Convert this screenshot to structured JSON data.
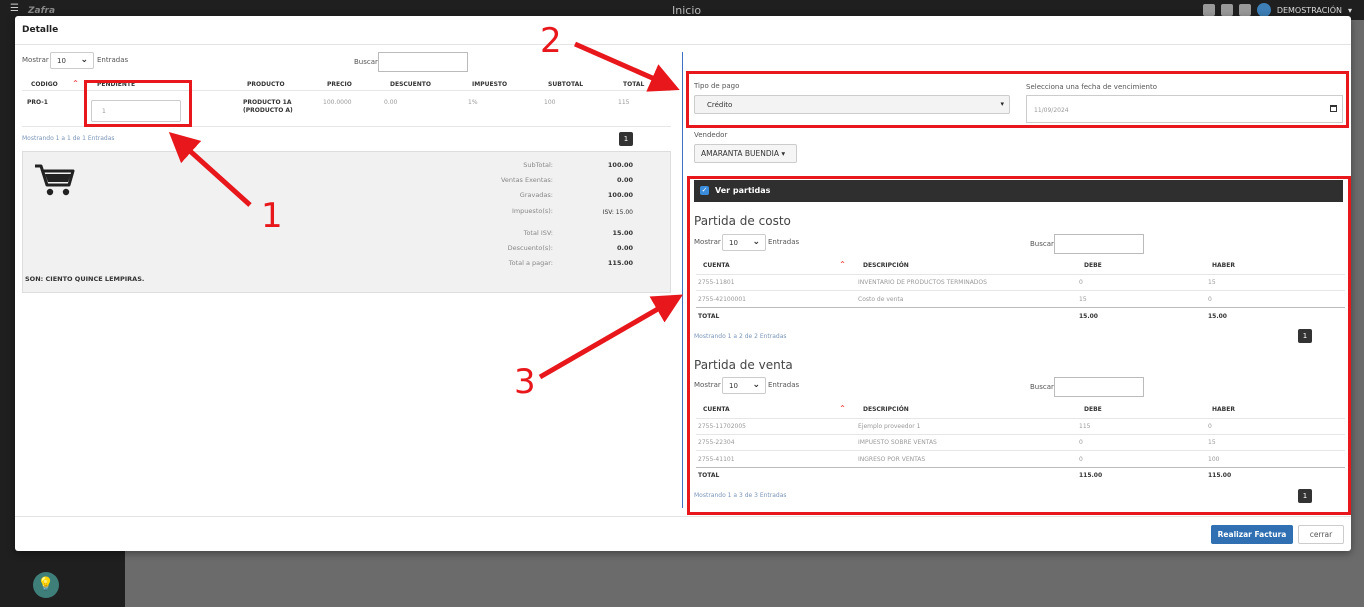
{
  "topbar": {
    "title": "Inicio",
    "logo": "Zafra",
    "user": "DEMOSTRACIÓN"
  },
  "modal": {
    "title": "Detalle"
  },
  "left": {
    "show_label": "Mostrar",
    "show_value": "10",
    "entries_label": "Entradas",
    "search_label": "Buscar:",
    "columns": [
      "CODIGO",
      "PENDIENTE",
      "PRODUCTO",
      "PRECIO",
      "DESCUENTO",
      "IMPUESTO",
      "SUBTOTAL",
      "TOTAL"
    ],
    "row": {
      "codigo": "PRO-1",
      "pendiente": "1",
      "producto_1": "PRODUCTO 1A",
      "producto_2": "(PRODUCTO A)",
      "precio": "100.0000",
      "descuento": "0.00",
      "impuesto": "1%",
      "subtotal": "100",
      "total": "115"
    },
    "info": "Mostrando 1 a 1 de 1 Entradas",
    "page": "1",
    "summary": {
      "subtotal_lbl": "SubTotal:",
      "subtotal_val": "100.00",
      "exentas_lbl": "Ventas Exentas:",
      "exentas_val": "0.00",
      "gravadas_lbl": "Gravadas:",
      "gravadas_val": "100.00",
      "impuesto_lbl": "Impuesto(s):",
      "impuesto_val": "ISV: 15.00",
      "totalisv_lbl": "Total ISV:",
      "totalisv_val": "15.00",
      "descuento_lbl": "Descuento(s):",
      "descuento_val": "0.00",
      "totalpagar_lbl": "Total a pagar:",
      "totalpagar_val": "115.00",
      "son": "SON: CIENTO QUINCE LEMPIRAS."
    }
  },
  "right": {
    "tipo_pago_label": "Tipo de pago",
    "tipo_pago_value": "Crédito",
    "fecha_label": "Selecciona una fecha de vencimiento",
    "fecha_value": "11/09/2024",
    "vendedor_label": "Vendedor",
    "vendedor_value": "AMARANTA BUENDIA",
    "ver_partidas": "Ver partidas",
    "costo": {
      "title": "Partida de costo",
      "show_label": "Mostrar",
      "show_value": "10",
      "entries_label": "Entradas",
      "search_label": "Buscar:",
      "columns": [
        "CUENTA",
        "DESCRIPCIÓN",
        "DEBE",
        "HABER"
      ],
      "rows": [
        {
          "cuenta": "2755-11801",
          "desc": "INVENTARIO DE PRODUCTOS TERMINADOS",
          "debe": "0",
          "haber": "15"
        },
        {
          "cuenta": "2755-42100001",
          "desc": "Costo de venta",
          "debe": "15",
          "haber": "0"
        }
      ],
      "total_label": "TOTAL",
      "total_debe": "15.00",
      "total_haber": "15.00",
      "info": "Mostrando 1 a 2 de 2 Entradas",
      "page": "1"
    },
    "venta": {
      "title": "Partida de venta",
      "show_label": "Mostrar",
      "show_value": "10",
      "entries_label": "Entradas",
      "search_label": "Buscar:",
      "columns": [
        "CUENTA",
        "DESCRIPCIÓN",
        "DEBE",
        "HABER"
      ],
      "rows": [
        {
          "cuenta": "2755-11702005",
          "desc": "Ejemplo proveedor 1",
          "debe": "115",
          "haber": "0"
        },
        {
          "cuenta": "2755-22304",
          "desc": "IMPUESTO SOBRE VENTAS",
          "debe": "0",
          "haber": "15"
        },
        {
          "cuenta": "2755-41101",
          "desc": "INGRESO POR VENTAS",
          "debe": "0",
          "haber": "100"
        }
      ],
      "total_label": "TOTAL",
      "total_debe": "115.00",
      "total_haber": "115.00",
      "info": "Mostrando 1 a 3 de 3 Entradas",
      "page": "1"
    }
  },
  "footer": {
    "realizar": "Realizar Factura",
    "cerrar": "cerrar"
  },
  "annotations": {
    "n1": "1",
    "n2": "2",
    "n3": "3",
    "color": "#e8171b"
  }
}
